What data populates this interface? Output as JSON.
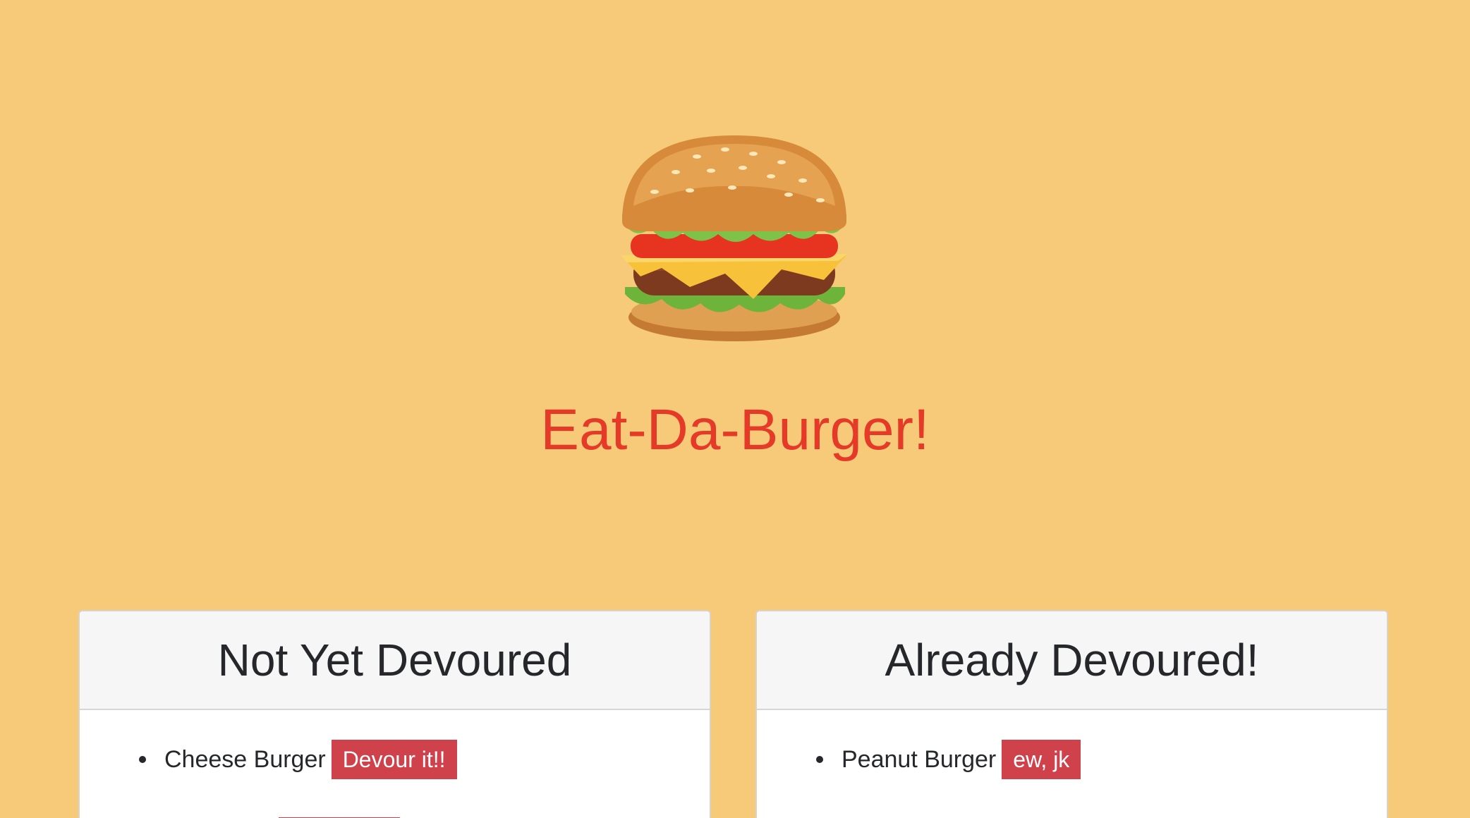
{
  "header": {
    "logo_icon": "hamburger-icon",
    "title": "Eat-Da-Burger!",
    "title_color": "#e63a29"
  },
  "background_color": "#f6ca78",
  "columns": [
    {
      "heading": "Not Yet Devoured",
      "items": [
        {
          "name": "Cheese Burger",
          "action_label": "Devour it!!"
        }
      ]
    },
    {
      "heading": "Already Devoured!",
      "items": [
        {
          "name": "Peanut Burger",
          "action_label": "ew, jk"
        }
      ]
    }
  ],
  "button_color": "#cf414b"
}
